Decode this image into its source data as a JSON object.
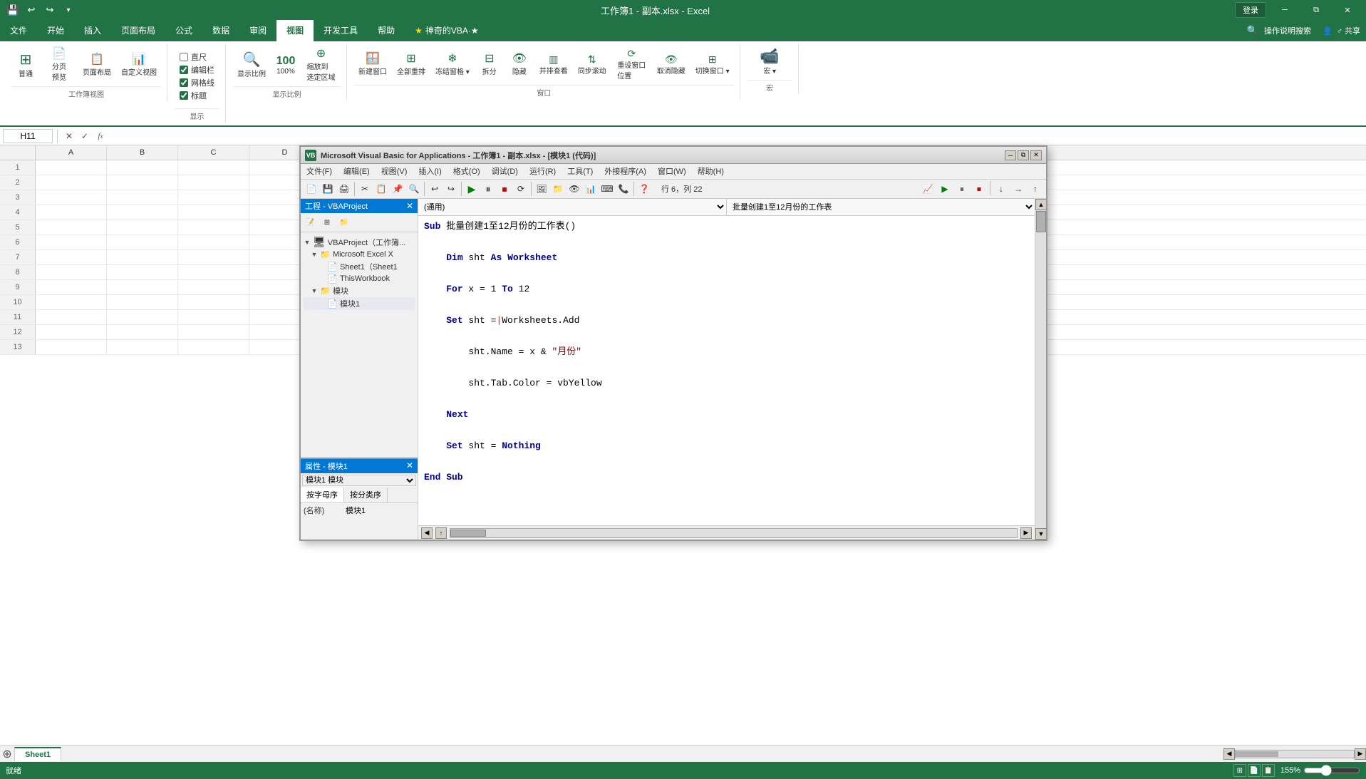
{
  "titlebar": {
    "filename": "工作簿1 - 副本.xlsx - Excel",
    "login": "登录"
  },
  "ribbon": {
    "tabs": [
      "文件",
      "开始",
      "插入",
      "页面布局",
      "公式",
      "数据",
      "审阅",
      "视图",
      "开发工具",
      "帮助",
      "★·神奇的VBA·★"
    ],
    "active_tab": "视图",
    "groups": {
      "workbook_view": {
        "label": "工作簿视图",
        "buttons": [
          "普通",
          "分页预览",
          "页面布局",
          "自定义视图"
        ]
      },
      "show": {
        "label": "显示",
        "checkboxes": [
          "直尺",
          "编辑栏",
          "网格线",
          "标题"
        ]
      },
      "zoom": {
        "label": "显示比例",
        "buttons": [
          "显示比例",
          "100%",
          "缩放到选定区域"
        ]
      },
      "window": {
        "label": "窗口",
        "buttons": [
          "新建窗口",
          "全部重排",
          "冻结窗格",
          "拆分",
          "隐藏",
          "并排查看",
          "同步滚动",
          "重设窗口位置",
          "取消隐藏",
          "切换窗口"
        ]
      },
      "macros": {
        "label": "宏",
        "buttons": [
          "宏"
        ]
      }
    }
  },
  "formula_bar": {
    "cell_ref": "H11",
    "formula": ""
  },
  "spreadsheet": {
    "columns": [
      "A",
      "B",
      "C",
      "D"
    ],
    "rows": 13
  },
  "sheet_tabs": [
    "Sheet1"
  ],
  "status_bar": {
    "status": "就绪",
    "zoom": "155%"
  },
  "vba_window": {
    "title": "Microsoft Visual Basic for Applications - 工作簿1 - 副本.xlsx - [模块1 (代码)]",
    "menu_items": [
      "文件(F)",
      "编辑(E)",
      "视图(V)",
      "插入(I)",
      "格式(O)",
      "调试(D)",
      "运行(R)",
      "工具(T)",
      "外接程序(A)",
      "窗口(W)",
      "帮助(H)"
    ],
    "toolbar_info": "行 6，列 22",
    "scope_select": "(通用)",
    "proc_select": "批量创建1至12月份的工作表",
    "code": [
      {
        "type": "sub_decl",
        "text": "Sub 批量创建1至12月份的工作表()"
      },
      {
        "type": "dim",
        "text": "    Dim sht As Worksheet"
      },
      {
        "type": "for",
        "text": "    For x = 1 To 12"
      },
      {
        "type": "set",
        "text": "    Set sht = Worksheets.Add"
      },
      {
        "type": "stmt",
        "text": "        sht.Name = x & \"月份\""
      },
      {
        "type": "stmt",
        "text": "        sht.Tab.Color = vbYellow"
      },
      {
        "type": "next",
        "text": "    Next"
      },
      {
        "type": "set",
        "text": "    Set sht = Nothing"
      },
      {
        "type": "end",
        "text": "End Sub"
      }
    ],
    "project_panel": {
      "title": "工程 - VBAProject",
      "tree": [
        {
          "level": 0,
          "expand": "▼",
          "icon": "⊞",
          "text": "VBAProject（工作簿..."
        },
        {
          "level": 1,
          "expand": "▼",
          "icon": "📁",
          "text": "Microsoft Excel X"
        },
        {
          "level": 2,
          "expand": " ",
          "icon": "📄",
          "text": "Sheet1（Sheet1"
        },
        {
          "level": 2,
          "expand": " ",
          "icon": "📄",
          "text": "ThisWorkbook"
        },
        {
          "level": 1,
          "expand": "▼",
          "icon": "📁",
          "text": "模块"
        },
        {
          "level": 2,
          "expand": " ",
          "icon": "📄",
          "text": "模块1"
        }
      ]
    },
    "properties_panel": {
      "title": "属性 - 模块1",
      "module_name": "模块1 模块",
      "tabs": [
        "按字母序",
        "按分类序"
      ],
      "active_tab": "按字母序",
      "prop_name": "(名称)",
      "prop_value": "模块1"
    }
  }
}
